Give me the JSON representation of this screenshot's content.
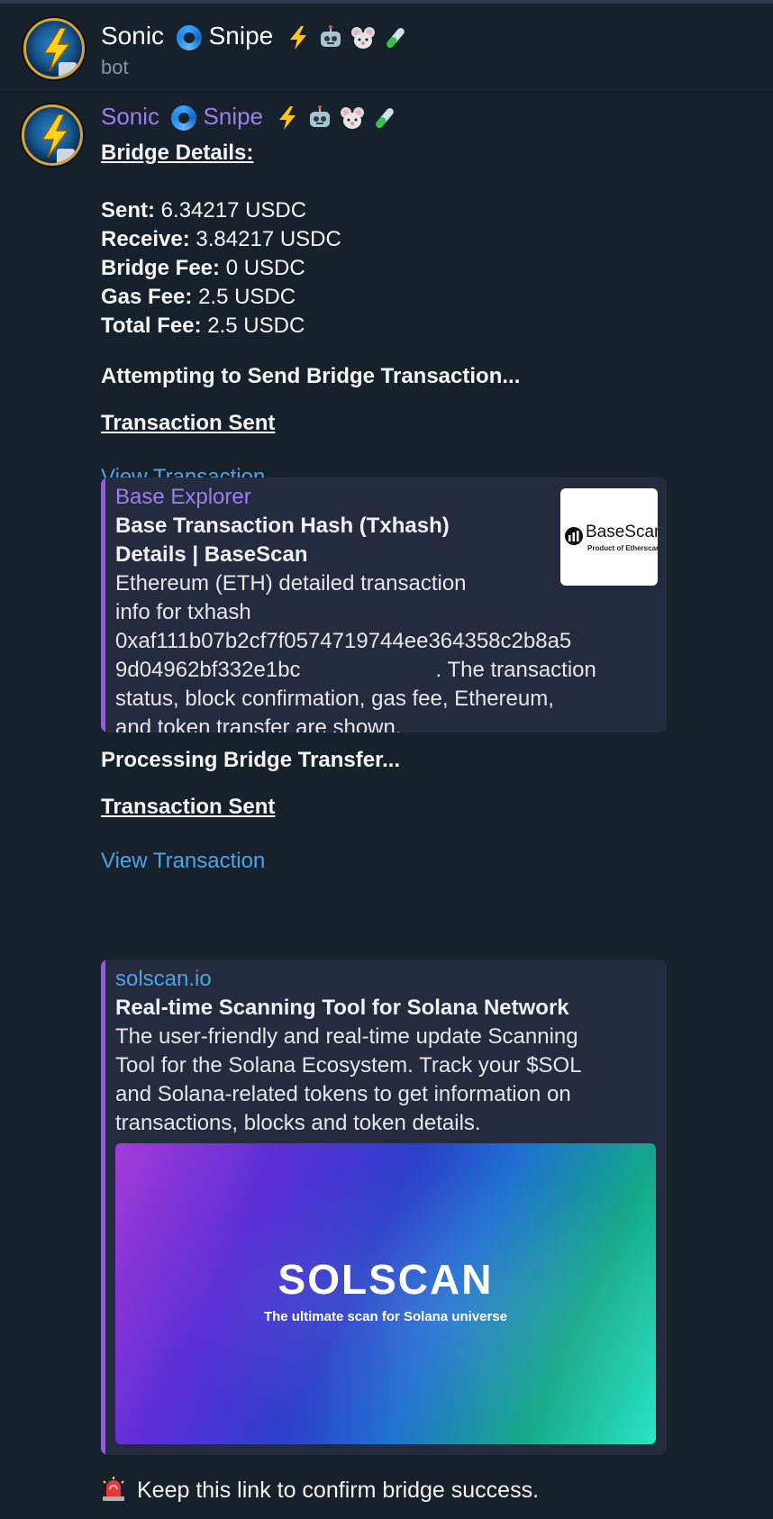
{
  "chat": {
    "title": "Sonic",
    "title_word2": "Snipe",
    "subtitle": "bot"
  },
  "message": {
    "sender_name": "Sonic",
    "sender_word2": "Snipe",
    "heading": "Bridge Details:",
    "details": [
      {
        "label": "Sent:",
        "value": "6.34217 USDC"
      },
      {
        "label": "Receive:",
        "value": "3.84217 USDC"
      },
      {
        "label": "Bridge Fee:",
        "value": "0 USDC"
      },
      {
        "label": "Gas Fee:",
        "value": "2.5 USDC"
      },
      {
        "label": "Total Fee:",
        "value": "2.5 USDC"
      }
    ],
    "attempting": "Attempting to Send Bridge Transaction...",
    "tx_sent_1": "Transaction Sent",
    "view_tx_1": "View Transaction",
    "preview1": {
      "site": "Base Explorer",
      "title_line1": "Base Transaction Hash (Txhash)",
      "title_line2": "Details | BaseScan",
      "desc_line1": "Ethereum (ETH) detailed transaction",
      "desc_line2": "info for txhash",
      "desc_line3": "0xaf111b07b2cf7f0574719744ee364358c2b8a5",
      "desc_line4a": "9d04962bf332e1bc",
      "desc_line4b": ". The transaction",
      "desc_line5": "status, block confirmation, gas fee, Ethereum,",
      "desc_line6": "and token transfer are shown.",
      "thumb_name": "BaseScan",
      "thumb_sub": "Product of Etherscan"
    },
    "processing": "Processing Bridge Transfer...",
    "tx_sent_2": "Transaction Sent",
    "view_tx_2": "View Transaction",
    "preview2": {
      "site": "solscan.io",
      "title": "Real-time Scanning Tool for Solana Network",
      "desc_line1": "The user-friendly and real-time update Scanning",
      "desc_line2": "Tool for the Solana Ecosystem. Track your $SOL",
      "desc_line3": "and Solana-related tokens to get information on",
      "desc_line4": "transactions, blocks and token details.",
      "image_logo": "SOLSCAN",
      "image_tagline": "The ultimate scan for Solana universe"
    },
    "footer_note": "Keep this link to confirm bridge success."
  },
  "colors": {
    "background": "#17212b",
    "sender": "#9f7cf0",
    "link": "#4da3e8",
    "preview_bg": "#242b3f",
    "preview_bar": "#8f63d6"
  },
  "icons": [
    "cyclone-emoji",
    "lightning-emoji",
    "robot-emoji",
    "mouse-emoji",
    "test-tube-emoji",
    "siren-emoji"
  ]
}
